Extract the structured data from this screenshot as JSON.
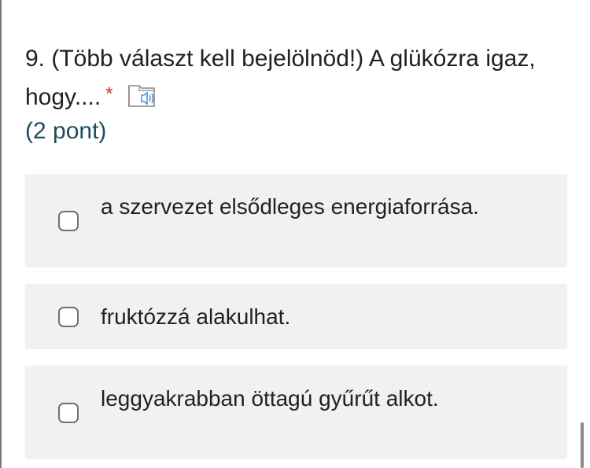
{
  "question": {
    "text": "9. (Több választ kell bejelölnöd!) A glükózra igaz, hogy....",
    "required_marker": "*",
    "points": "(2 pont)",
    "speaker_icon": "read-aloud-icon"
  },
  "options": [
    {
      "label": "a szervezet elsődleges energiaforrása.",
      "checked": false
    },
    {
      "label": "fruktózzá alakulhat.",
      "checked": false
    },
    {
      "label": "leggyakrabban öttagú gyűrűt alkot.",
      "checked": false
    }
  ],
  "colors": {
    "option_background": "#f1f1f1",
    "required": "#d93025",
    "points_text": "#1e4e5f",
    "text": "#202124"
  }
}
